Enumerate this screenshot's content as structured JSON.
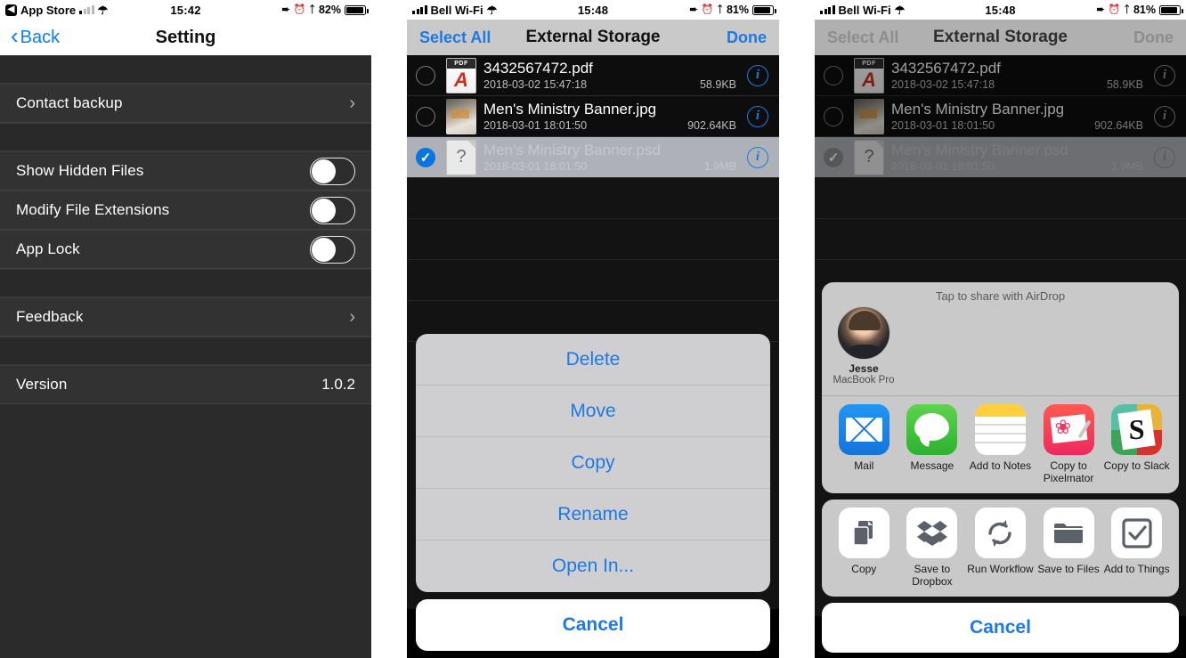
{
  "panels": {
    "settings": {
      "status": {
        "app_back_label": "App Store",
        "time": "15:42",
        "battery_pct": "82%",
        "icons": [
          "location-arrow-icon",
          "alarm-icon",
          "bluetooth-icon"
        ]
      },
      "nav": {
        "back_label": "Back",
        "title": "Setting"
      },
      "rows": [
        {
          "label": "Contact backup",
          "type": "disclosure"
        },
        {
          "label": "Show Hidden Files",
          "type": "switch",
          "on": false
        },
        {
          "label": "Modify File Extensions",
          "type": "switch",
          "on": false
        },
        {
          "label": "App Lock",
          "type": "switch",
          "on": false
        },
        {
          "label": "Feedback",
          "type": "disclosure"
        },
        {
          "label": "Version",
          "type": "value",
          "value": "1.0.2"
        }
      ]
    },
    "actions": {
      "status": {
        "carrier": "Bell Wi-Fi",
        "time": "15:48",
        "battery_pct": "81%"
      },
      "nav": {
        "select_all": "Select All",
        "title": "External Storage",
        "done": "Done"
      },
      "files": [
        {
          "name": "3432567472.pdf",
          "date": "2018-03-02 15:47:18",
          "size": "58.9KB",
          "kind": "pdf",
          "selected": false
        },
        {
          "name": "Men's Ministry Banner.jpg",
          "date": "2018-03-01 18:01:50",
          "size": "902.64KB",
          "kind": "img",
          "selected": false
        },
        {
          "name": "Men's Ministry Banner.psd",
          "date": "2018-03-01 18:01:50",
          "size": "1.9MB",
          "kind": "unknown",
          "selected": true
        }
      ],
      "sheet": {
        "items": [
          "Delete",
          "Move",
          "Copy",
          "Rename",
          "Open In..."
        ],
        "cancel": "Cancel"
      }
    },
    "share": {
      "status": {
        "carrier": "Bell Wi-Fi",
        "time": "15:48",
        "battery_pct": "81%"
      },
      "nav": {
        "select_all": "Select All",
        "title": "External Storage",
        "done": "Done"
      },
      "files": [
        {
          "name": "3432567472.pdf",
          "date": "2018-03-02 15:47:18",
          "size": "58.9KB",
          "kind": "pdf",
          "selected": false
        },
        {
          "name": "Men's Ministry Banner.jpg",
          "date": "2018-03-01 18:01:50",
          "size": "902.64KB",
          "kind": "img",
          "selected": false
        },
        {
          "name": "Men's Ministry Banner.psd",
          "date": "2018-03-01 18:01:50",
          "size": "1.9MB",
          "kind": "unknown",
          "selected": true
        }
      ],
      "airdrop": {
        "title": "Tap to share with AirDrop",
        "person_name": "Jesse",
        "person_device": "MacBook Pro"
      },
      "apps": [
        {
          "label": "Mail",
          "icon": "mail-icon"
        },
        {
          "label": "Message",
          "icon": "messages-icon"
        },
        {
          "label": "Add to Notes",
          "icon": "notes-icon"
        },
        {
          "label": "Copy to Pixelmator",
          "icon": "pixelmator-icon"
        },
        {
          "label": "Copy to Slack",
          "icon": "slack-icon"
        }
      ],
      "actions": [
        {
          "label": "Copy",
          "icon": "copy-icon"
        },
        {
          "label": "Save to Dropbox",
          "icon": "dropbox-icon"
        },
        {
          "label": "Run Workflow",
          "icon": "workflow-icon"
        },
        {
          "label": "Save to Files",
          "icon": "folder-icon"
        },
        {
          "label": "Add to Things",
          "icon": "checkbox-icon"
        }
      ],
      "cancel": "Cancel"
    }
  },
  "colors": {
    "accent_blue": "#1f78e5",
    "selected_blue": "#0a74e0",
    "dark_bg": "#2b2b2b"
  }
}
